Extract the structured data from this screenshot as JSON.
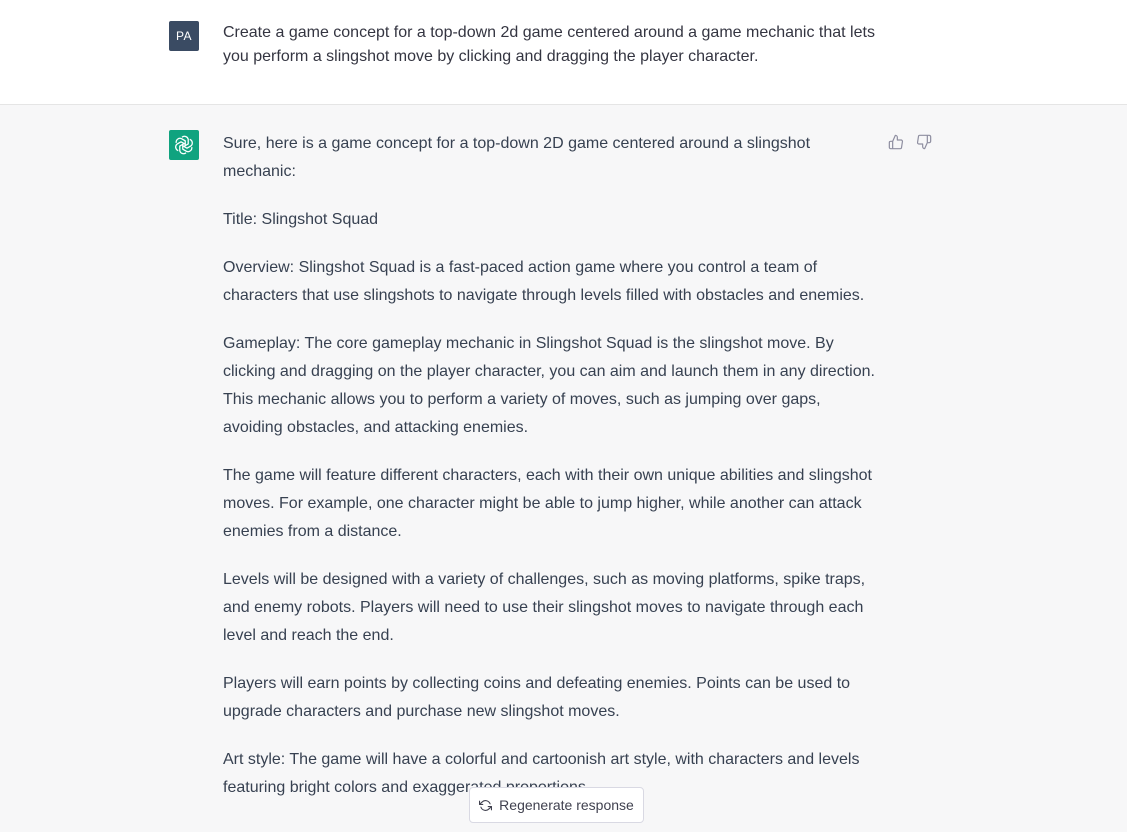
{
  "colors": {
    "user_avatar_bg": "#3a4b63",
    "bot_avatar_bg": "#10a37f",
    "user_block_bg": "#ffffff",
    "assistant_block_bg": "#f7f7f8",
    "text": "#374151"
  },
  "user": {
    "avatar_initials": "PA",
    "message": "Create a game concept for a top-down 2d game centered around a game mechanic that lets you perform a slingshot move by clicking and dragging the player character."
  },
  "assistant": {
    "avatar_icon": "openai-logo-icon",
    "paragraphs": [
      "Sure, here is a game concept for a top-down 2D game centered around a slingshot mechanic:",
      "Title: Slingshot Squad",
      "Overview: Slingshot Squad is a fast-paced action game where you control a team of characters that use slingshots to navigate through levels filled with obstacles and enemies.",
      "Gameplay: The core gameplay mechanic in Slingshot Squad is the slingshot move. By clicking and dragging on the player character, you can aim and launch them in any direction. This mechanic allows you to perform a variety of moves, such as jumping over gaps, avoiding obstacles, and attacking enemies.",
      "The game will feature different characters, each with their own unique abilities and slingshot moves. For example, one character might be able to jump higher, while another can attack enemies from a distance.",
      "Levels will be designed with a variety of challenges, such as moving platforms, spike traps, and enemy robots. Players will need to use their slingshot moves to navigate through each level and reach the end.",
      "Players will earn points by collecting coins and defeating enemies. Points can be used to upgrade characters and purchase new slingshot moves.",
      "Art style: The game will have a colorful and cartoonish art style, with characters and levels featuring bright colors and exaggerated proportions."
    ],
    "feedback_icons": [
      "thumbs-up-icon",
      "thumbs-down-icon"
    ]
  },
  "footer": {
    "regenerate_label": "Regenerate response",
    "regenerate_icon": "refresh-icon"
  }
}
